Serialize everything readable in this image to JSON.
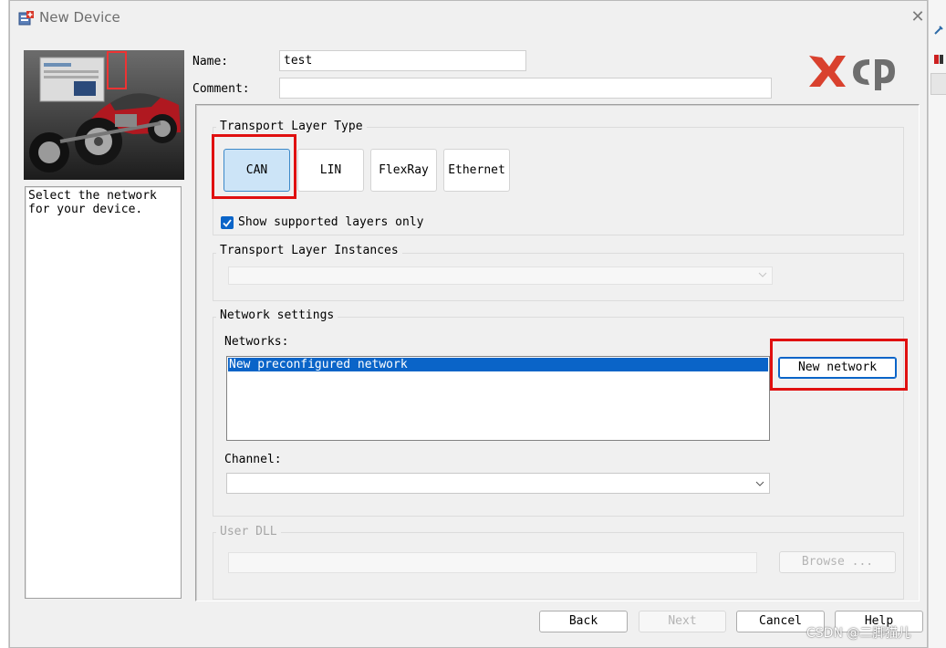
{
  "window": {
    "title": "New Device",
    "close_glyph": "✕",
    "icon": "new-device-icon"
  },
  "hero": {
    "image": "car-simulation-illustration"
  },
  "logo": {
    "text": "XCP",
    "colors": [
      "#d9412e",
      "#6e6e6e"
    ]
  },
  "form": {
    "name_label": "Name:",
    "name_value": "test",
    "comment_label": "Comment:",
    "comment_value": ""
  },
  "description": {
    "text": "Select the network for your device."
  },
  "transport_layer_type": {
    "title": "Transport Layer Type",
    "options": [
      "CAN",
      "LIN",
      "FlexRay",
      "Ethernet"
    ],
    "selected": "CAN",
    "show_supported_label": "Show supported layers only",
    "show_supported_checked": true
  },
  "transport_layer_instances": {
    "title": "Transport Layer Instances",
    "selected": ""
  },
  "network_settings": {
    "title": "Network settings",
    "networks_label": "Networks:",
    "networks": [
      "New preconfigured network"
    ],
    "selected_network": "New preconfigured network",
    "new_network_button": "New network",
    "channel_label": "Channel:",
    "channel_value": ""
  },
  "user_dll": {
    "title": "User DLL",
    "path": "",
    "browse_button": "Browse ..."
  },
  "footer": {
    "back": "Back",
    "next": "Next",
    "cancel": "Cancel",
    "help": "Help"
  },
  "watermark": "CSDN @二脚猫儿",
  "colors": {
    "accent": "#0a64c8",
    "selected_button": "#cce4f7",
    "highlight": "#e01010"
  }
}
